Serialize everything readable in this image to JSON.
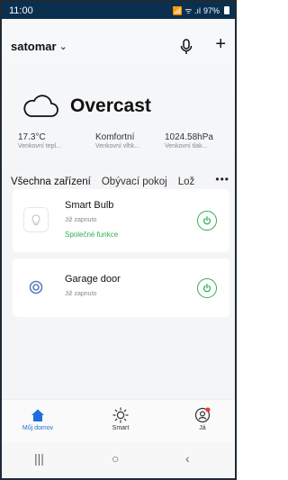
{
  "status_bar": {
    "time": "11:00",
    "signal_text": "📶 ᯤ .ıl",
    "battery": "97%"
  },
  "header": {
    "home_name": "satomar",
    "home_chevron": "⌄",
    "mic_icon": "microphone-icon",
    "add_label": "+"
  },
  "weather": {
    "condition": "Overcast",
    "icon": "cloud-icon",
    "stats": [
      {
        "value": "17.3°C",
        "label": "Venkovní tepl..."
      },
      {
        "value": "Komfortní",
        "label": "Venkovní vlhk..."
      },
      {
        "value": "1024.58hPa",
        "label": "Venkovní tlak..."
      }
    ]
  },
  "tabs": {
    "items": [
      "Všechna zařízení",
      "Obývací pokoj",
      "Lož"
    ],
    "active_index": 0,
    "more_label": "•••"
  },
  "devices": [
    {
      "name": "Smart Bulb",
      "status": "Již zapnuto",
      "extra": "Společné funkce",
      "icon": "bulb-icon"
    },
    {
      "name": "Garage door",
      "status": "Již zapnuto",
      "icon": "garage-door-icon"
    }
  ],
  "bottom_nav": [
    {
      "label": "Můj domov",
      "icon": "home-icon",
      "active": true
    },
    {
      "label": "Smart",
      "icon": "sun-icon",
      "active": false
    },
    {
      "label": "Já",
      "icon": "profile-icon",
      "active": false
    }
  ],
  "system_nav": {
    "recents": "|||",
    "home": "○",
    "back": "‹"
  },
  "colors": {
    "accent": "#1e6fd9",
    "power_green": "#2fae58",
    "status_bar_bg": "#0b2f4f"
  }
}
